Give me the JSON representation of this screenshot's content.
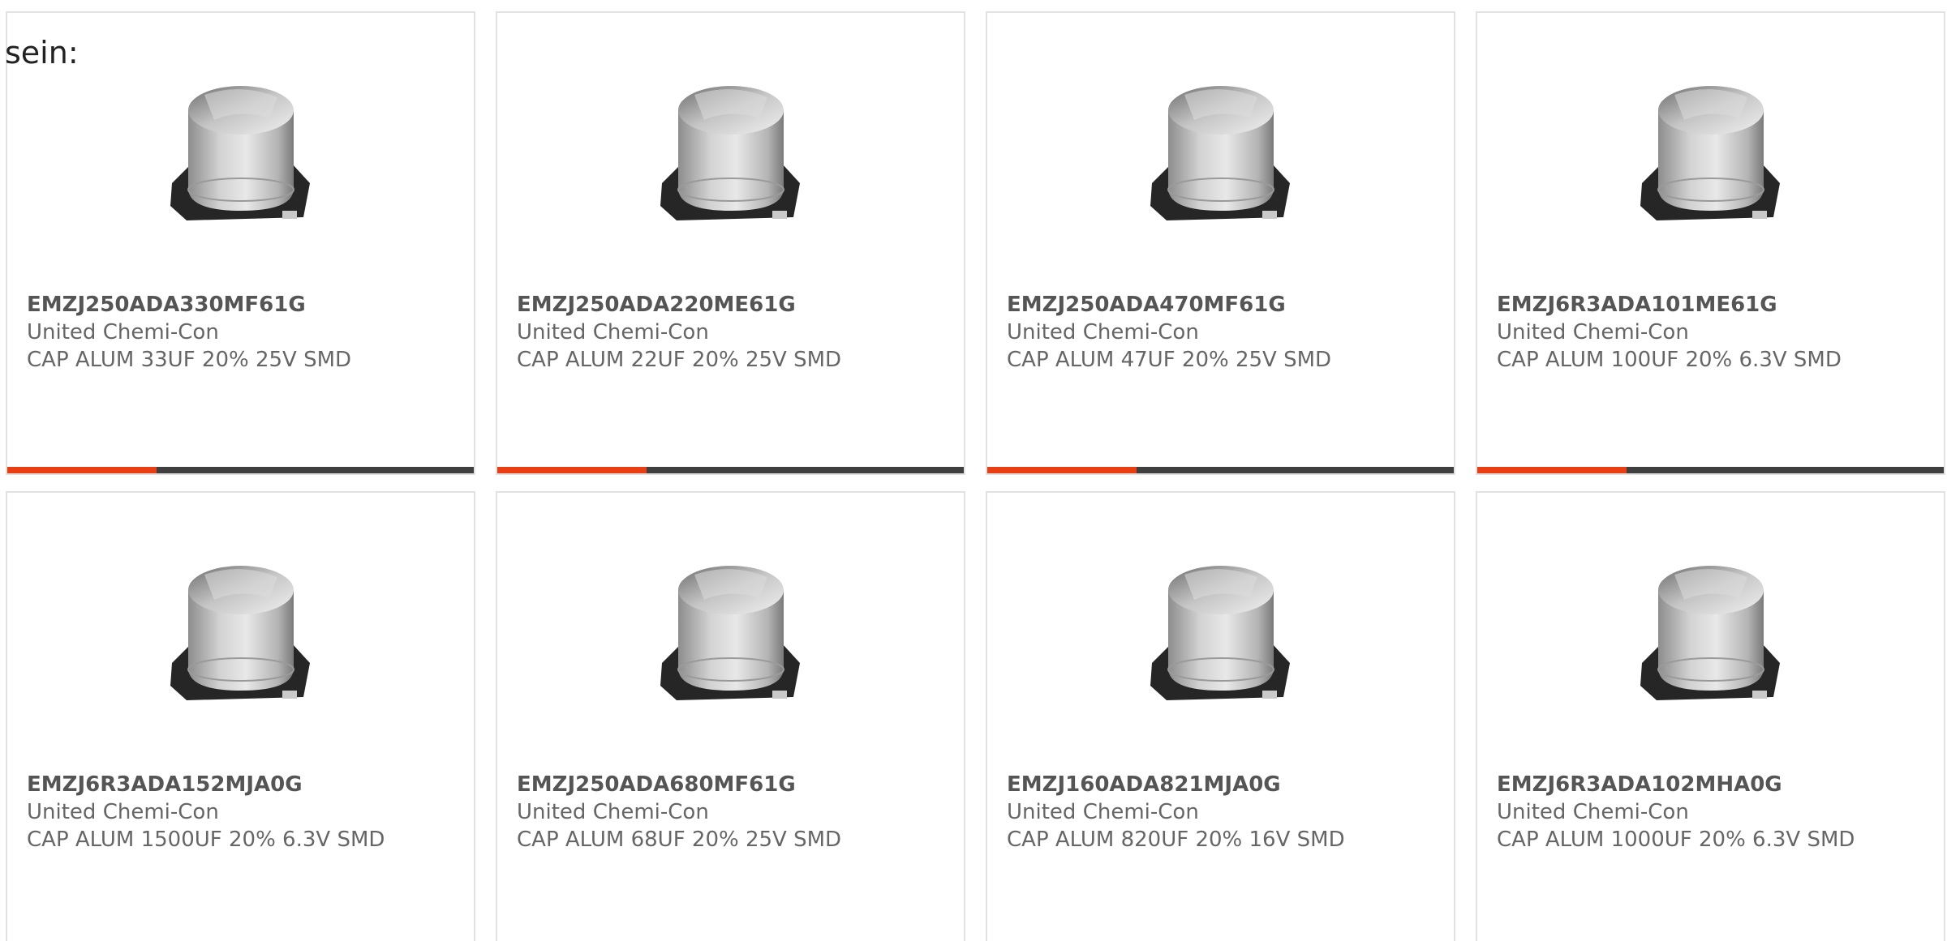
{
  "intro_text": "sein:",
  "colors": {
    "accent": "#e83e12",
    "bar_track": "#3f3f3f",
    "card_border": "#e2e2e2",
    "text": "#666666"
  },
  "products": [
    {
      "part_number": "EMZJ250ADA330MF61G",
      "manufacturer": "United Chemi-Con",
      "description": "CAP ALUM 33UF 20% 25V SMD",
      "progress_fraction": 0.32,
      "image_icon": "smd-capacitor-image"
    },
    {
      "part_number": "EMZJ250ADA220ME61G",
      "manufacturer": "United Chemi-Con",
      "description": "CAP ALUM 22UF 20% 25V SMD",
      "progress_fraction": 0.32,
      "image_icon": "smd-capacitor-image"
    },
    {
      "part_number": "EMZJ250ADA470MF61G",
      "manufacturer": "United Chemi-Con",
      "description": "CAP ALUM 47UF 20% 25V SMD",
      "progress_fraction": 0.32,
      "image_icon": "smd-capacitor-image"
    },
    {
      "part_number": "EMZJ6R3ADA101ME61G",
      "manufacturer": "United Chemi-Con",
      "description": "CAP ALUM 100UF 20% 6.3V SMD",
      "progress_fraction": 0.32,
      "image_icon": "smd-capacitor-image"
    },
    {
      "part_number": "EMZJ6R3ADA152MJA0G",
      "manufacturer": "United Chemi-Con",
      "description": "CAP ALUM 1500UF 20% 6.3V SMD",
      "progress_fraction": 0,
      "image_icon": "smd-capacitor-image"
    },
    {
      "part_number": "EMZJ250ADA680MF61G",
      "manufacturer": "United Chemi-Con",
      "description": "CAP ALUM 68UF 20% 25V SMD",
      "progress_fraction": 0,
      "image_icon": "smd-capacitor-image"
    },
    {
      "part_number": "EMZJ160ADA821MJA0G",
      "manufacturer": "United Chemi-Con",
      "description": "CAP ALUM 820UF 20% 16V SMD",
      "progress_fraction": 0,
      "image_icon": "smd-capacitor-image"
    },
    {
      "part_number": "EMZJ6R3ADA102MHA0G",
      "manufacturer": "United Chemi-Con",
      "description": "CAP ALUM 1000UF 20% 6.3V SMD",
      "progress_fraction": 0,
      "image_icon": "smd-capacitor-image"
    }
  ]
}
